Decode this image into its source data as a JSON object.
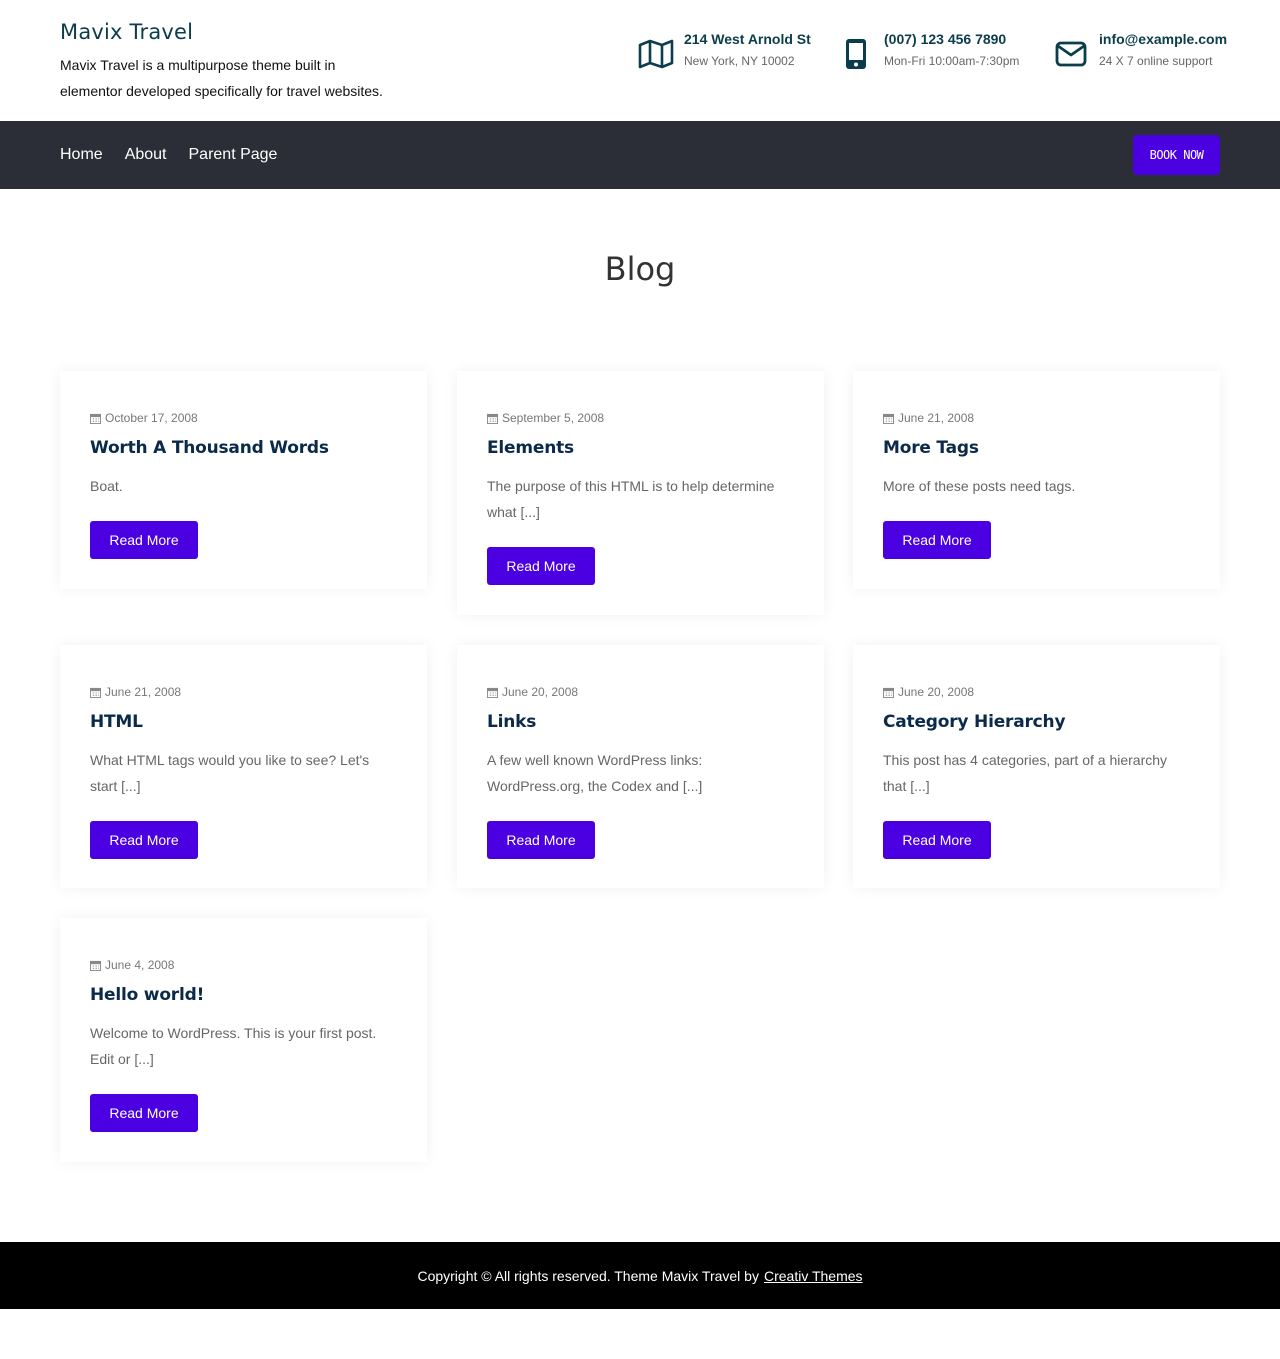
{
  "header": {
    "site_title": "Mavix Travel",
    "site_description": "Mavix Travel is a multipurpose theme built in elementor developed specifically for travel websites.",
    "contacts": [
      {
        "icon": "map-icon",
        "line1": "214 West Arnold St",
        "line2": "New York, NY 10002"
      },
      {
        "icon": "mobile-phone-icon",
        "line1": "(007) 123 456 7890",
        "line2": "Mon-Fri 10:00am-7:30pm"
      },
      {
        "icon": "envelope-icon",
        "line1": "info@example.com",
        "line2": "24 X 7 online support"
      }
    ],
    "accent_color": "#0b3d4a"
  },
  "nav": {
    "items": [
      "Home",
      "About",
      "Parent Page"
    ],
    "book_label": "BOOK NOW",
    "background": "#2b2e36"
  },
  "main": {
    "page_title": "Blog",
    "read_more_label": "Read More",
    "button_color": "#4a00e0",
    "posts": [
      {
        "date": "October 17, 2008",
        "title": "Worth A Thousand Words",
        "excerpt": "Boat."
      },
      {
        "date": "September 5, 2008",
        "title": "Elements",
        "excerpt": "The purpose of this HTML is to help determine what [...]"
      },
      {
        "date": "June 21, 2008",
        "title": "More Tags",
        "excerpt": "More of these posts need tags."
      },
      {
        "date": "June 21, 2008",
        "title": "HTML",
        "excerpt": "What HTML tags would you like to see? Let's start [...]"
      },
      {
        "date": "June 20, 2008",
        "title": "Links",
        "excerpt": "A few well known WordPress links: WordPress.org, the Codex and [...]"
      },
      {
        "date": "June 20, 2008",
        "title": "Category Hierarchy",
        "excerpt": "This post has 4 categories, part of a hierarchy that [...]"
      },
      {
        "date": "June 4, 2008",
        "title": "Hello world!",
        "excerpt": "Welcome to WordPress. This is your first post. Edit or [...]"
      }
    ]
  },
  "footer": {
    "text": "Copyright © All rights reserved. Theme Mavix Travel by",
    "link_text": "Creativ Themes"
  }
}
